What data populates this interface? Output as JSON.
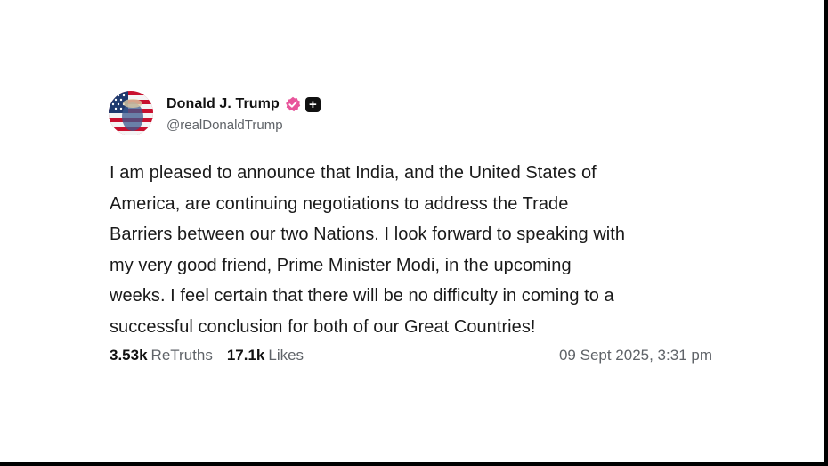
{
  "post": {
    "author": {
      "display_name": "Donald J. Trump",
      "handle": "@realDonaldTrump",
      "avatar_icon": "american-flag-portrait-avatar",
      "verified_icon": "verified-badge-icon",
      "verified_color": "#e8559b"
    },
    "lines": [
      "I am pleased to announce that India, and the United States of",
      "America, are continuing negotiations to address the Trade",
      "Barriers between our two Nations. I look forward to speaking with",
      "my very good friend, Prime Minister Modi, in the upcoming",
      "weeks. I feel certain that there will be no difficulty in coming to a",
      "successful conclusion for both of our Great Countries!"
    ],
    "stats": {
      "retruths_count": "3.53k",
      "retruths_label": "ReTruths",
      "likes_count": "17.1k",
      "likes_label": "Likes",
      "timestamp": "09 Sept 2025, 3:31 pm"
    }
  }
}
